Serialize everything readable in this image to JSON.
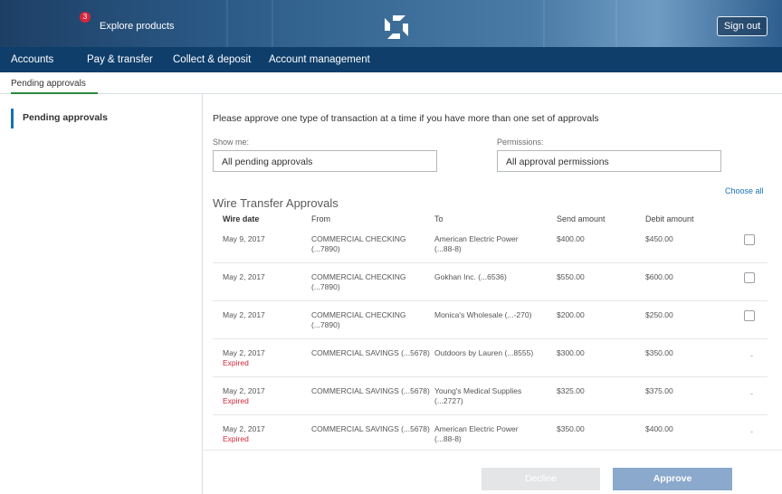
{
  "header": {
    "badge_count": "3",
    "explore_label": "Explore products",
    "sign_out_label": "Sign out",
    "logo_icon": "octagon-logo-icon"
  },
  "main_nav": {
    "items": [
      "Accounts",
      "Pay & transfer",
      "Collect & deposit",
      "Account management"
    ]
  },
  "sub_nav": {
    "active_tab": "Pending approvals"
  },
  "sidebar": {
    "items": [
      {
        "label": "Pending approvals",
        "active": true
      }
    ]
  },
  "content": {
    "intro": "Please approve one type of transaction at a time if you have more than one set of approvals",
    "show_me_label": "Show me:",
    "show_me_value": "All pending approvals",
    "permissions_label": "Permissions:",
    "permissions_value": "All approval permissions",
    "choose_all_label": "Choose all",
    "section_title": "Wire Transfer Approvals",
    "columns": [
      "Wire date",
      "From",
      "To",
      "Send amount",
      "Debit amount"
    ],
    "rows": [
      {
        "date": "May 9, 2017",
        "status": "",
        "from_l1": "COMMERCIAL CHECKING",
        "from_l2": "(...7890)",
        "to_l1": "American Electric Power",
        "to_l2": "(...88-8)",
        "send": "$400.00",
        "debit": "$450.00",
        "selectable": true
      },
      {
        "date": "May 2, 2017",
        "status": "",
        "from_l1": "COMMERCIAL CHECKING",
        "from_l2": "(...7890)",
        "to_l1": "Gokhan Inc. (...6536)",
        "to_l2": "",
        "send": "$550.00",
        "debit": "$600.00",
        "selectable": true
      },
      {
        "date": "May 2, 2017",
        "status": "",
        "from_l1": "COMMERCIAL CHECKING",
        "from_l2": "(...7890)",
        "to_l1": "Monica's Wholesale (...-270)",
        "to_l2": "",
        "send": "$200.00",
        "debit": "$250.00",
        "selectable": true
      },
      {
        "date": "May 2, 2017",
        "status": "Expired",
        "from_l1": "COMMERCIAL SAVINGS (...5678)",
        "from_l2": "",
        "to_l1": "Outdoors by Lauren (...8555)",
        "to_l2": "",
        "send": "$300.00",
        "debit": "$350.00",
        "selectable": false,
        "dash": "-"
      },
      {
        "date": "May 2, 2017",
        "status": "Expired",
        "from_l1": "COMMERCIAL SAVINGS (...5678)",
        "from_l2": "",
        "to_l1": "Young's Medical Supplies",
        "to_l2": "(...2727)",
        "send": "$325.00",
        "debit": "$375.00",
        "selectable": false,
        "dash": "-"
      },
      {
        "date": "May 2, 2017",
        "status": "Expired",
        "from_l1": "COMMERCIAL SAVINGS (...5678)",
        "from_l2": "",
        "to_l1": "American Electric Power",
        "to_l2": "(...88-8)",
        "send": "$350.00",
        "debit": "$400.00",
        "selectable": false,
        "dash": "-"
      }
    ],
    "decline_label": "Decline",
    "approve_label": "Approve"
  },
  "colors": {
    "nav_bg": "#0f3e6b",
    "link": "#1a6fb8",
    "expired": "#d4263a",
    "approve_bg": "#8aa9cc",
    "active_tab_underline": "#2a8a3c"
  }
}
